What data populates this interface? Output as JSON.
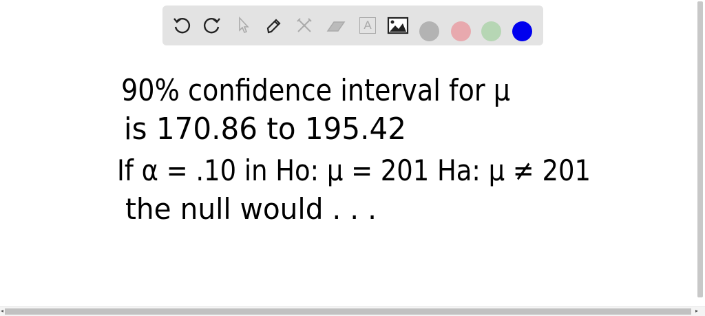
{
  "toolbar": {
    "tools": [
      {
        "name": "undo-icon",
        "enabled": true
      },
      {
        "name": "redo-icon",
        "enabled": true
      },
      {
        "name": "select-icon",
        "enabled": false
      },
      {
        "name": "pen-icon",
        "enabled": true
      },
      {
        "name": "tools-icon",
        "enabled": false
      },
      {
        "name": "eraser-icon",
        "enabled": false
      },
      {
        "name": "text-icon",
        "enabled": false,
        "label": "A"
      },
      {
        "name": "image-icon",
        "enabled": true
      }
    ],
    "colors": [
      "#b3b3b3",
      "#e8a9ae",
      "#b6d6b4",
      "#0000ee"
    ],
    "selected_color": "#0000ee"
  },
  "whiteboard": {
    "lines": [
      "90% confidence interval for μ",
      "is 170.86 to 195.42",
      "If α = .10   in Ho: μ = 201   Ha: μ ≠ 201",
      "the null would . . ."
    ]
  }
}
